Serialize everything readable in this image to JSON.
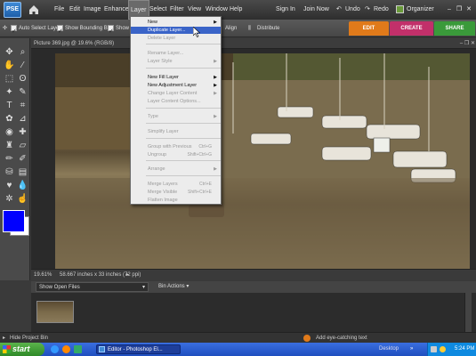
{
  "app": {
    "logo_text": "PSE"
  },
  "menubar": {
    "items": [
      "File",
      "Edit",
      "Image",
      "Enhance",
      "Layer",
      "Select",
      "Filter",
      "View",
      "Window",
      "Help"
    ],
    "sign_in": "Sign In",
    "join_now": "Join Now",
    "undo": "Undo",
    "redo": "Redo",
    "organizer": "Organizer"
  },
  "options": {
    "auto_select": "Auto Select Layer",
    "show_bounding": "Show Bounding Box",
    "show_highlight": "Show",
    "align": "Align",
    "distribute": "Distribute"
  },
  "mode_tabs": {
    "edit": "EDIT",
    "create": "CREATE",
    "share": "SHARE"
  },
  "document": {
    "title": "Picture 369.jpg @ 19.6% (RGB/8)",
    "zoom": "19.61%",
    "doc_info": "58.667 inches x 33 inches (72 ppi)"
  },
  "bin": {
    "dropdown": "Show Open Files",
    "actions": "Bin Actions",
    "hide": "Hide Project Bin",
    "hint": "Add eye-catching text"
  },
  "layer_menu": {
    "new": "New",
    "duplicate": "Duplicate Layer...",
    "delete": "Delete Layer",
    "rename": "Rename Layer...",
    "style": "Layer Style",
    "new_fill": "New Fill Layer",
    "new_adjustment": "New Adjustment Layer",
    "change_content": "Change Layer Content",
    "content_options": "Layer Content Options...",
    "type": "Type",
    "simplify": "Simplify Layer",
    "group": "Group with Previous",
    "group_sc": "Ctrl+G",
    "ungroup": "Ungroup",
    "ungroup_sc": "Shift+Ctrl+G",
    "arrange": "Arrange",
    "merge_layers": "Merge Layers",
    "merge_layers_sc": "Ctrl+E",
    "merge_visible": "Merge Visible",
    "merge_visible_sc": "Shift+Ctrl+E",
    "flatten": "Flatten Image"
  },
  "taskbar": {
    "start": "start",
    "editor_task": "Editor - Photoshop El...",
    "desktop": "Desktop",
    "clock": "5:24 PM"
  },
  "colors": {
    "foreground": "#0000ff",
    "background": "#ffffff",
    "edit_tab": "#e07a1a",
    "create_tab": "#c2306a",
    "share_tab": "#3a9a3a"
  }
}
